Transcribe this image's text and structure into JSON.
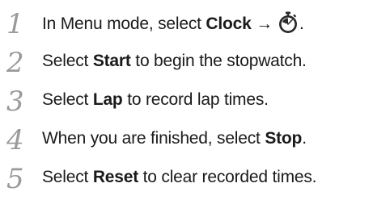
{
  "steps": [
    {
      "number": "1",
      "before": "In Menu mode, select ",
      "bold": "Clock",
      "after": " →",
      "icon": "stopwatch-icon",
      "tail": "."
    },
    {
      "number": "2",
      "before": "Select ",
      "bold": "Start",
      "after": " to begin the stopwatch."
    },
    {
      "number": "3",
      "before": "Select ",
      "bold": "Lap",
      "after": " to record lap times."
    },
    {
      "number": "4",
      "before": "When you are finished, select ",
      "bold": "Stop",
      "after": "."
    },
    {
      "number": "5",
      "before": "Select ",
      "bold": "Reset",
      "after": " to clear recorded times."
    }
  ],
  "colors": {
    "step_number": "#9a9a9a",
    "text": "#1a1a1a",
    "icon_fill": "#2b2b2b"
  }
}
